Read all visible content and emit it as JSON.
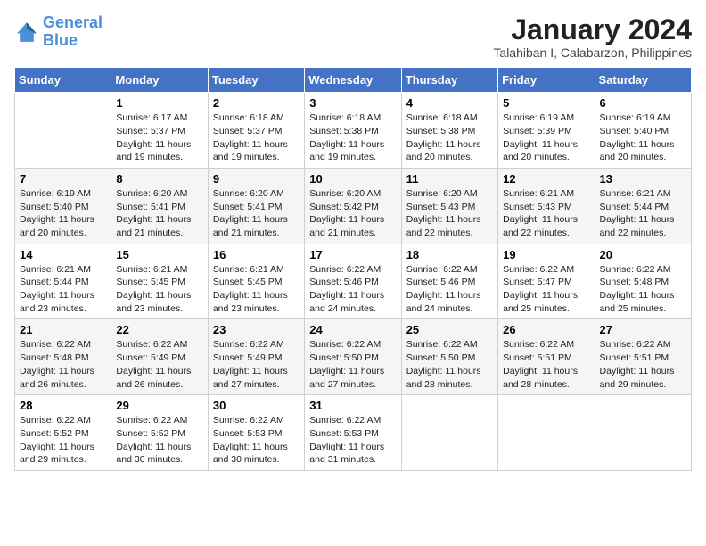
{
  "header": {
    "logo_line1": "General",
    "logo_line2": "Blue",
    "month_year": "January 2024",
    "location": "Talahiban I, Calabarzon, Philippines"
  },
  "weekdays": [
    "Sunday",
    "Monday",
    "Tuesday",
    "Wednesday",
    "Thursday",
    "Friday",
    "Saturday"
  ],
  "weeks": [
    [
      {
        "day": "",
        "info": ""
      },
      {
        "day": "1",
        "info": "Sunrise: 6:17 AM\nSunset: 5:37 PM\nDaylight: 11 hours\nand 19 minutes."
      },
      {
        "day": "2",
        "info": "Sunrise: 6:18 AM\nSunset: 5:37 PM\nDaylight: 11 hours\nand 19 minutes."
      },
      {
        "day": "3",
        "info": "Sunrise: 6:18 AM\nSunset: 5:38 PM\nDaylight: 11 hours\nand 19 minutes."
      },
      {
        "day": "4",
        "info": "Sunrise: 6:18 AM\nSunset: 5:38 PM\nDaylight: 11 hours\nand 20 minutes."
      },
      {
        "day": "5",
        "info": "Sunrise: 6:19 AM\nSunset: 5:39 PM\nDaylight: 11 hours\nand 20 minutes."
      },
      {
        "day": "6",
        "info": "Sunrise: 6:19 AM\nSunset: 5:40 PM\nDaylight: 11 hours\nand 20 minutes."
      }
    ],
    [
      {
        "day": "7",
        "info": "Sunrise: 6:19 AM\nSunset: 5:40 PM\nDaylight: 11 hours\nand 20 minutes."
      },
      {
        "day": "8",
        "info": "Sunrise: 6:20 AM\nSunset: 5:41 PM\nDaylight: 11 hours\nand 21 minutes."
      },
      {
        "day": "9",
        "info": "Sunrise: 6:20 AM\nSunset: 5:41 PM\nDaylight: 11 hours\nand 21 minutes."
      },
      {
        "day": "10",
        "info": "Sunrise: 6:20 AM\nSunset: 5:42 PM\nDaylight: 11 hours\nand 21 minutes."
      },
      {
        "day": "11",
        "info": "Sunrise: 6:20 AM\nSunset: 5:43 PM\nDaylight: 11 hours\nand 22 minutes."
      },
      {
        "day": "12",
        "info": "Sunrise: 6:21 AM\nSunset: 5:43 PM\nDaylight: 11 hours\nand 22 minutes."
      },
      {
        "day": "13",
        "info": "Sunrise: 6:21 AM\nSunset: 5:44 PM\nDaylight: 11 hours\nand 22 minutes."
      }
    ],
    [
      {
        "day": "14",
        "info": "Sunrise: 6:21 AM\nSunset: 5:44 PM\nDaylight: 11 hours\nand 23 minutes."
      },
      {
        "day": "15",
        "info": "Sunrise: 6:21 AM\nSunset: 5:45 PM\nDaylight: 11 hours\nand 23 minutes."
      },
      {
        "day": "16",
        "info": "Sunrise: 6:21 AM\nSunset: 5:45 PM\nDaylight: 11 hours\nand 23 minutes."
      },
      {
        "day": "17",
        "info": "Sunrise: 6:22 AM\nSunset: 5:46 PM\nDaylight: 11 hours\nand 24 minutes."
      },
      {
        "day": "18",
        "info": "Sunrise: 6:22 AM\nSunset: 5:46 PM\nDaylight: 11 hours\nand 24 minutes."
      },
      {
        "day": "19",
        "info": "Sunrise: 6:22 AM\nSunset: 5:47 PM\nDaylight: 11 hours\nand 25 minutes."
      },
      {
        "day": "20",
        "info": "Sunrise: 6:22 AM\nSunset: 5:48 PM\nDaylight: 11 hours\nand 25 minutes."
      }
    ],
    [
      {
        "day": "21",
        "info": "Sunrise: 6:22 AM\nSunset: 5:48 PM\nDaylight: 11 hours\nand 26 minutes."
      },
      {
        "day": "22",
        "info": "Sunrise: 6:22 AM\nSunset: 5:49 PM\nDaylight: 11 hours\nand 26 minutes."
      },
      {
        "day": "23",
        "info": "Sunrise: 6:22 AM\nSunset: 5:49 PM\nDaylight: 11 hours\nand 27 minutes."
      },
      {
        "day": "24",
        "info": "Sunrise: 6:22 AM\nSunset: 5:50 PM\nDaylight: 11 hours\nand 27 minutes."
      },
      {
        "day": "25",
        "info": "Sunrise: 6:22 AM\nSunset: 5:50 PM\nDaylight: 11 hours\nand 28 minutes."
      },
      {
        "day": "26",
        "info": "Sunrise: 6:22 AM\nSunset: 5:51 PM\nDaylight: 11 hours\nand 28 minutes."
      },
      {
        "day": "27",
        "info": "Sunrise: 6:22 AM\nSunset: 5:51 PM\nDaylight: 11 hours\nand 29 minutes."
      }
    ],
    [
      {
        "day": "28",
        "info": "Sunrise: 6:22 AM\nSunset: 5:52 PM\nDaylight: 11 hours\nand 29 minutes."
      },
      {
        "day": "29",
        "info": "Sunrise: 6:22 AM\nSunset: 5:52 PM\nDaylight: 11 hours\nand 30 minutes."
      },
      {
        "day": "30",
        "info": "Sunrise: 6:22 AM\nSunset: 5:53 PM\nDaylight: 11 hours\nand 30 minutes."
      },
      {
        "day": "31",
        "info": "Sunrise: 6:22 AM\nSunset: 5:53 PM\nDaylight: 11 hours\nand 31 minutes."
      },
      {
        "day": "",
        "info": ""
      },
      {
        "day": "",
        "info": ""
      },
      {
        "day": "",
        "info": ""
      }
    ]
  ]
}
